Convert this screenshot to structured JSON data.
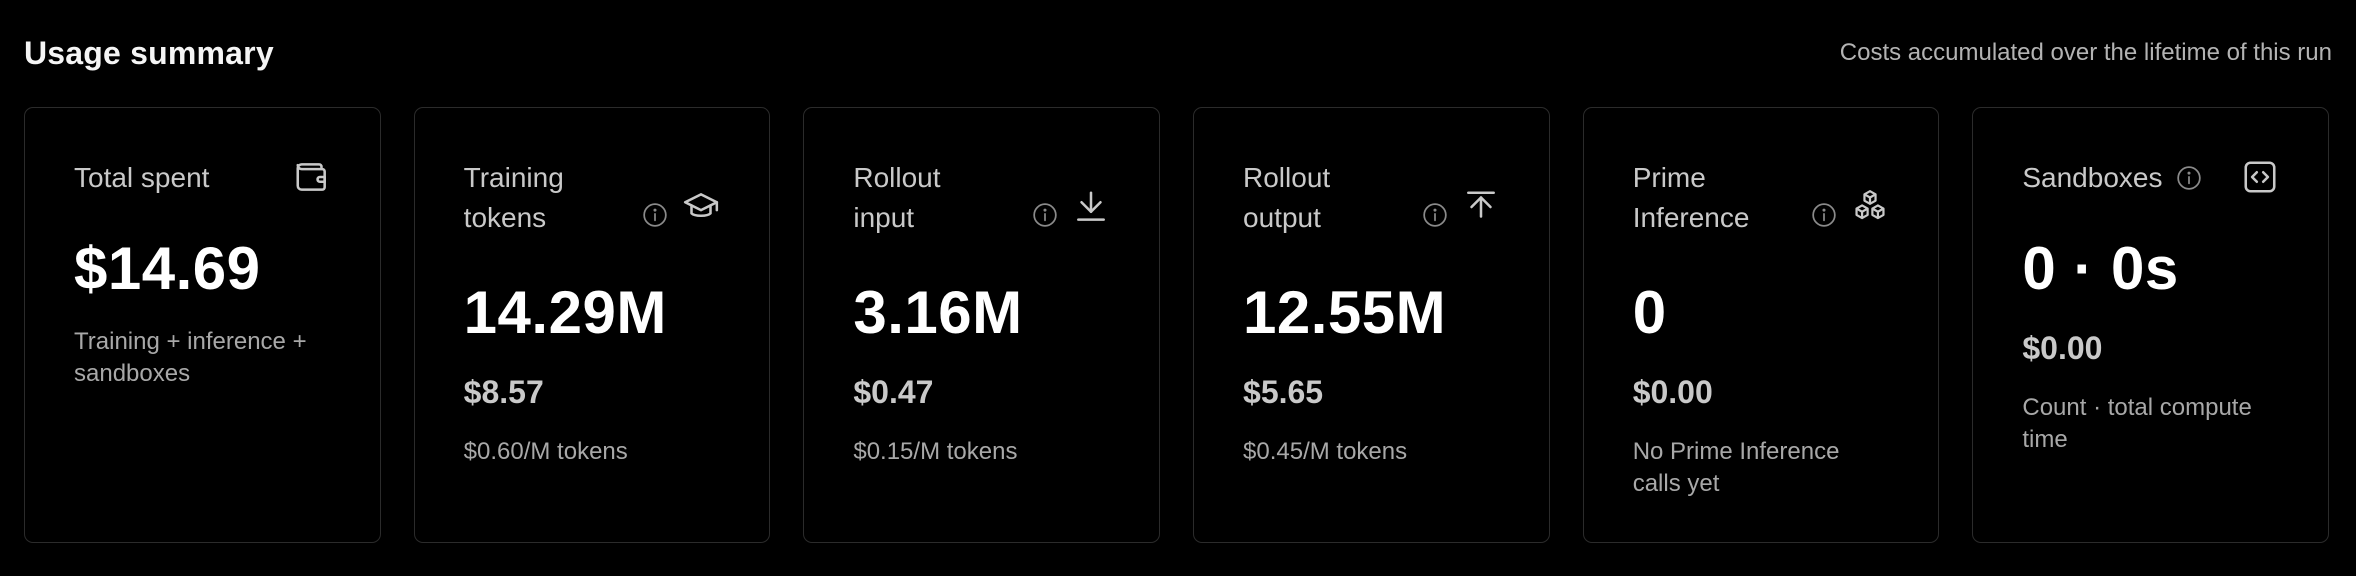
{
  "header": {
    "title": "Usage summary",
    "subtitle": "Costs accumulated over the lifetime of this run"
  },
  "cards": [
    {
      "title": "Total spent",
      "icon": "wallet-icon",
      "value": "$14.69",
      "description": "Training + inference + sandboxes"
    },
    {
      "title": "Training tokens",
      "icon": "graduation-cap-icon",
      "value": "14.29M",
      "cost": "$8.57",
      "description": "$0.60/M tokens"
    },
    {
      "title": "Rollout input",
      "icon": "download-icon",
      "value": "3.16M",
      "cost": "$0.47",
      "description": "$0.15/M tokens"
    },
    {
      "title": "Rollout output",
      "icon": "upload-icon",
      "value": "12.55M",
      "cost": "$5.65",
      "description": "$0.45/M tokens"
    },
    {
      "title": "Prime Inference",
      "icon": "cubes-icon",
      "value": "0",
      "cost": "$0.00",
      "description": "No Prime Inference calls yet"
    },
    {
      "title": "Sandboxes",
      "icon": "code-icon",
      "value": "0 · 0s",
      "cost": "$0.00",
      "description": "Count · total compute time"
    }
  ],
  "colors": {
    "background": "#000000",
    "card_border": "#2b2b2b",
    "title_text": "#c9c9c9",
    "value_text": "#ffffff",
    "muted_text": "#a8a8a8"
  }
}
